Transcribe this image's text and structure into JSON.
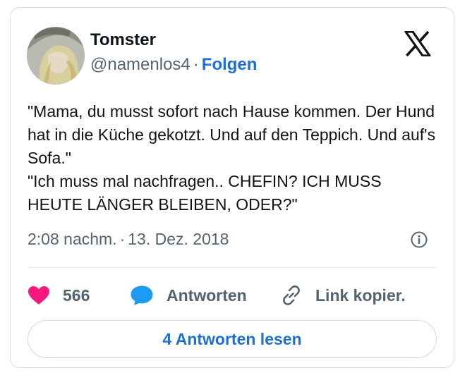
{
  "author": {
    "name": "Tomster",
    "handle": "@namenlos4",
    "separator": "·",
    "follow_label": "Folgen"
  },
  "tweet": {
    "lines": [
      "\"Mama, du musst sofort nach Hause kommen. Der Hund hat in die Küche gekotzt. Und auf den Teppich. Und auf's Sofa.\"",
      "\"Ich muss mal nachfragen.. CHEFIN? ICH MUSS HEUTE LÄNGER BLEIBEN, ODER?\""
    ],
    "time": "2:08 nachm.",
    "separator": "·",
    "date": "13. Dez. 2018"
  },
  "actions": {
    "like_count": "566",
    "reply_label": "Antworten",
    "copy_label": "Link kopier."
  },
  "read_replies_label": "4 Antworten lesen",
  "icons": {
    "platform": "x-logo-icon",
    "info": "info-icon",
    "like": "heart-icon",
    "reply": "speech-bubble-icon",
    "copy": "link-icon"
  },
  "colors": {
    "heart": "#f91880",
    "reply_bubble": "#1d9bf0",
    "link_accent": "#1d6fd6",
    "secondary_text": "#536471"
  }
}
